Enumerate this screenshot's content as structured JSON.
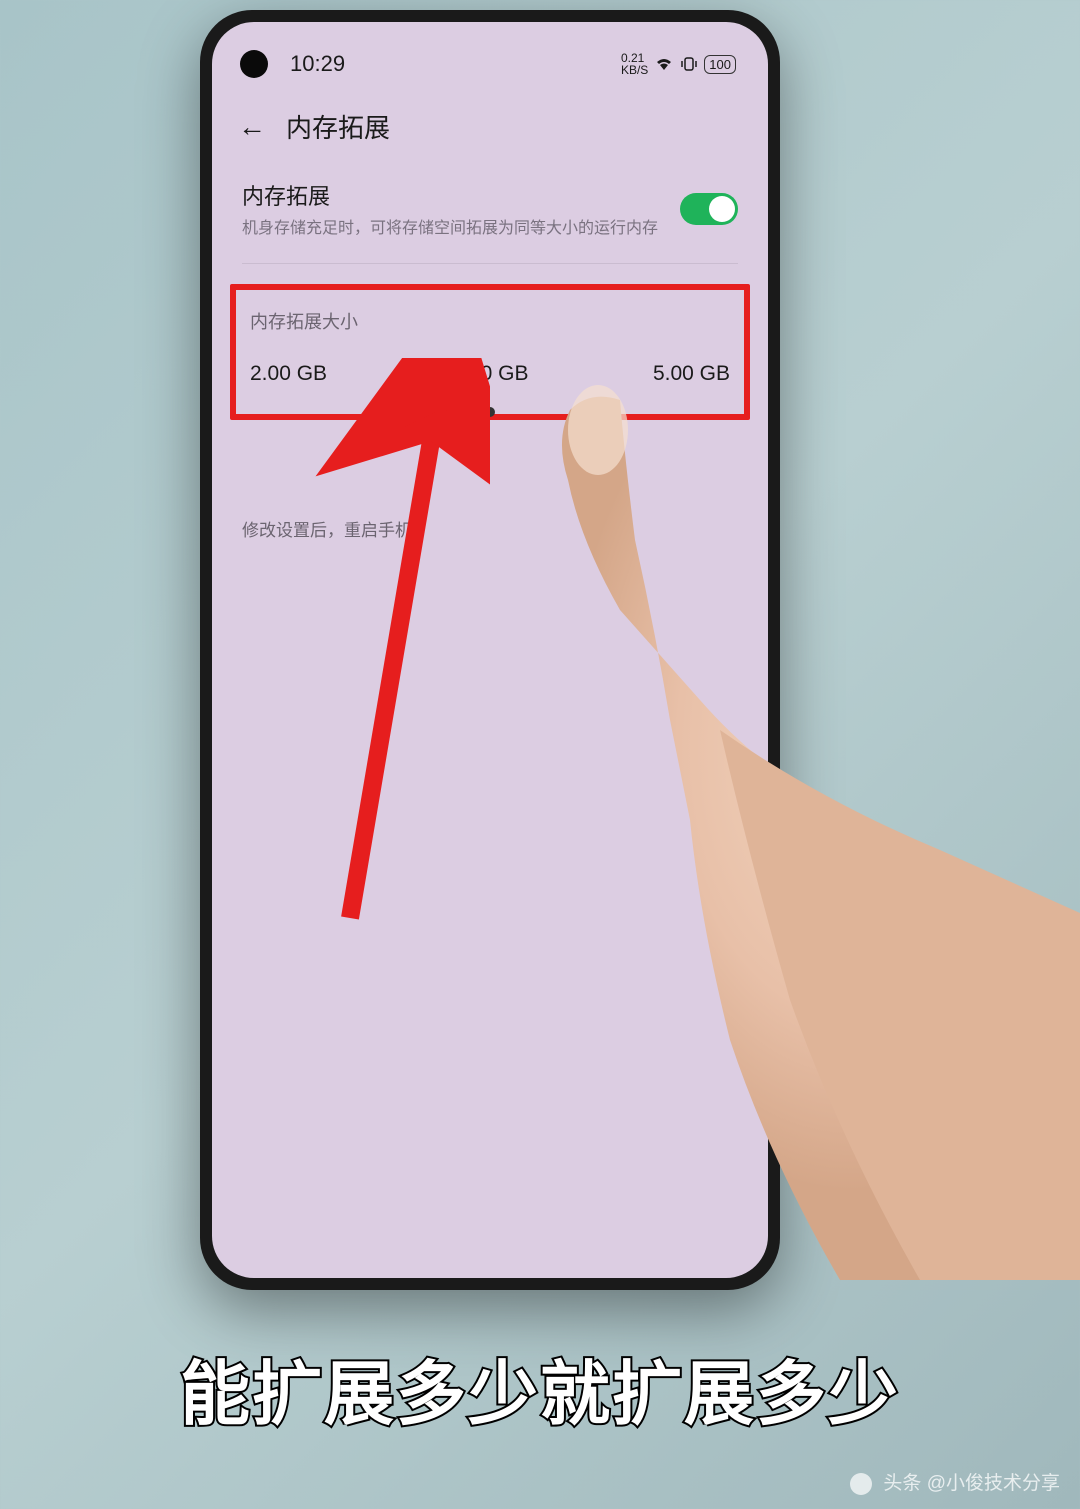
{
  "status_bar": {
    "time": "10:29",
    "speed": "0.21",
    "speed_unit": "KB/S",
    "battery": "100"
  },
  "header": {
    "title": "内存拓展"
  },
  "toggle_section": {
    "title": "内存拓展",
    "description": "机身存储充足时，可将存储空间拓展为同等大小的运行内存",
    "enabled": true
  },
  "size_section": {
    "label": "内存拓展大小",
    "options": [
      "2.00 GB",
      "3.00 GB",
      "5.00 GB"
    ],
    "selected_index": 1
  },
  "restart_note": "修改设置后，重启手机",
  "caption": "能扩展多少就扩展多少",
  "attribution": "头条 @小俊技术分享"
}
